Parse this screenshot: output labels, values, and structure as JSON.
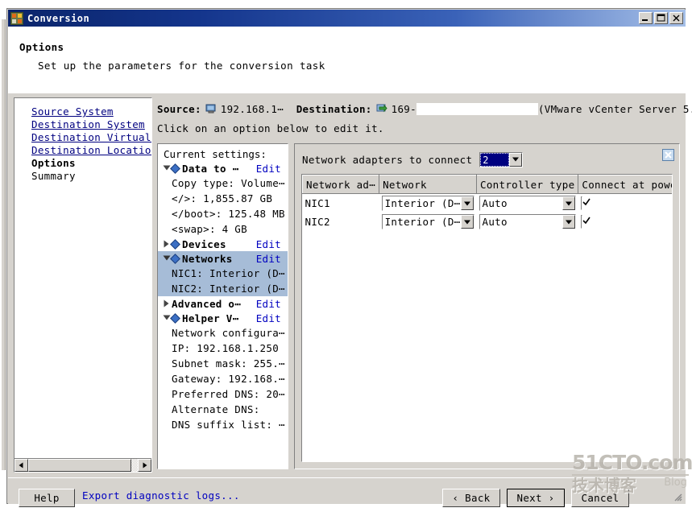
{
  "window": {
    "title": "Conversion",
    "icon": "converter-app-icon",
    "buttons": {
      "minimize": "minimize-icon",
      "maximize": "maximize-icon",
      "close": "close-icon"
    }
  },
  "header": {
    "title": "Options",
    "subtitle": "Set up the parameters for the conversion task"
  },
  "nav": {
    "items": [
      {
        "label": "Source System",
        "state": "link"
      },
      {
        "label": "Destination System",
        "state": "link"
      },
      {
        "label": "Destination Virtual M",
        "state": "link"
      },
      {
        "label": "Destination Location",
        "state": "link"
      },
      {
        "label": "Options",
        "state": "current"
      },
      {
        "label": "Summary",
        "state": "plain"
      }
    ]
  },
  "task_bar": {
    "source_label": "Source:",
    "source_icon": "computer-icon",
    "source_value": "192.168.1⋯",
    "destination_label": "Destination:",
    "destination_icon": "vm-convert-icon",
    "destination_value": "169-",
    "destination_redacted": "",
    "server_note": "(VMware vCenter Server 5.⋯",
    "instruction": "Click on an option below to edit it."
  },
  "settings": {
    "heading": "Current settings:",
    "rows": [
      {
        "kind": "group",
        "expander": "expanded",
        "diamond": true,
        "label": "Data to ⋯",
        "edit": "Edit",
        "selected": false
      },
      {
        "kind": "sub",
        "label": "Copy type: Volume⋯",
        "selected": false
      },
      {
        "kind": "sub",
        "label": "</>: 1,855.87 GB",
        "selected": false
      },
      {
        "kind": "sub",
        "label": "</boot>: 125.48 MB",
        "selected": false
      },
      {
        "kind": "sub",
        "label": "<swap>: 4 GB",
        "selected": false
      },
      {
        "kind": "group",
        "expander": "collapsed",
        "diamond": true,
        "label": "Devices",
        "edit": "Edit",
        "selected": false
      },
      {
        "kind": "group",
        "expander": "expanded",
        "diamond": true,
        "label": "Networks",
        "edit": "Edit",
        "selected": true
      },
      {
        "kind": "sub",
        "label": "NIC1: Interior (D⋯",
        "selected": true
      },
      {
        "kind": "sub",
        "label": "NIC2: Interior (D⋯",
        "selected": true
      },
      {
        "kind": "group",
        "expander": "collapsed",
        "diamond": false,
        "label": "Advanced o⋯",
        "edit": "Edit",
        "selected": false
      },
      {
        "kind": "group",
        "expander": "expanded",
        "diamond": true,
        "label": "Helper V⋯",
        "edit": "Edit",
        "selected": false
      },
      {
        "kind": "sub",
        "label": "Network configura⋯",
        "selected": false
      },
      {
        "kind": "sub",
        "label": "IP: 192.168.1.250",
        "selected": false
      },
      {
        "kind": "sub",
        "label": "Subnet mask: 255.⋯",
        "selected": false
      },
      {
        "kind": "sub",
        "label": "Gateway: 192.168.⋯",
        "selected": false
      },
      {
        "kind": "sub",
        "label": "Preferred DNS: 20⋯",
        "selected": false
      },
      {
        "kind": "sub",
        "label": "Alternate DNS:",
        "selected": false
      },
      {
        "kind": "sub",
        "label": "DNS suffix list: ⋯",
        "selected": false
      }
    ]
  },
  "adapters": {
    "count_label": "Network adapters to connect",
    "count_value": "2",
    "close_icon": "close-panel-icon",
    "columns": [
      "Network ad⋯",
      "Network",
      "Controller type",
      "Connect at power-on"
    ],
    "rows": [
      {
        "adapter": "NIC1",
        "network": "Interior (D⋯",
        "controller": "Auto",
        "connect": true
      },
      {
        "adapter": "NIC2",
        "network": "Interior (D⋯",
        "controller": "Auto",
        "connect": true
      }
    ]
  },
  "footer": {
    "help": "Help",
    "export_logs": "Export diagnostic logs...",
    "back": "‹ Back",
    "next": "Next ›",
    "cancel": "Cancel"
  },
  "watermark": {
    "line1": "51CTO.com",
    "line2": "技术博客",
    "line3": "Blog"
  },
  "colors": {
    "window_face": "#d6d3ce",
    "title_start": "#0a246a",
    "title_end": "#a6c0e8",
    "link": "#000080",
    "selection": "#a6bcd7",
    "diamond": "#3b6fc4"
  }
}
